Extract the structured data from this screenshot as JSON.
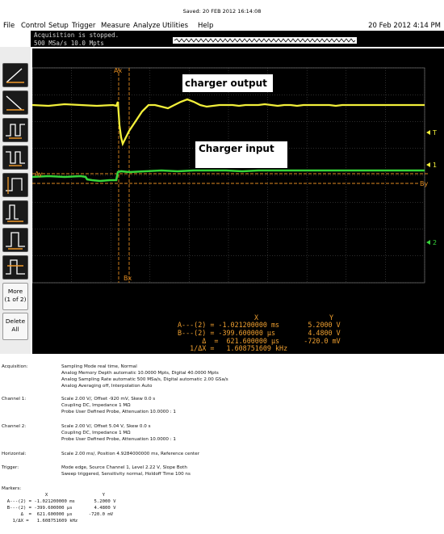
{
  "saved_line": "Saved:  20 FEB 2012  16:14:08",
  "menu": {
    "items": [
      "File",
      "Control",
      "Setup",
      "Trigger",
      "Measure",
      "Analyze",
      "Utilities",
      "Help"
    ],
    "datetime": "20 Feb 2012   4:14 PM"
  },
  "status": {
    "line1": "Acquisition is stopped.",
    "line2": "500 MSa/s    10.0 Mpts"
  },
  "toolbar": {
    "icons": [
      "rising-edge-icon",
      "falling-edge-icon",
      "pulse-width-icon",
      "pulse-width-inverse-icon",
      "timeout-icon",
      "runt-icon",
      "transition-icon",
      "setup-hold-icon",
      "glitch-icon"
    ],
    "more_label_1": "More",
    "more_label_2": "(1 of 2)",
    "delete_label_1": "Delete",
    "delete_label_2": "All"
  },
  "screen": {
    "annotation_output": "charger output",
    "annotation_input": "Charger input",
    "marker_ax": "Ax",
    "marker_bx": "Bx",
    "marker_ay": "Ay",
    "marker_by": "By",
    "marker_t": "T",
    "marker_ch1": "1",
    "marker_ch2": "2",
    "colors": {
      "channel1": "#f2ef3a",
      "channel2": "#36d43a",
      "cursor": "#e08a20",
      "grid": "#5a5a5a",
      "readout": "#f0a030"
    }
  },
  "readout": {
    "header_x": "X",
    "header_y": "Y",
    "row_a": "A---(2) = -1.021200000 ms       5.2000 V",
    "row_b": "B---(2) = -399.600000 µs        4.4800 V",
    "row_delta": "      Δ  =  621.600000 µs      -720.0 mV",
    "row_inv": "   1/ΔX =   1.608751609 kHz"
  },
  "report": {
    "acquisition_label": "Acquisition:",
    "acquisition_lines": [
      "Sampling Mode real time, Normal",
      "Analog Memory Depth automatic 10.0000 Mpts, Digital 40.0000 Mpts",
      "Analog Sampling Rate automatic 500 MSa/s, Digital automatic 2.00 GSa/s",
      "Analog Averaging off, Interpolation Auto"
    ],
    "channel1_label": "Channel 1:",
    "channel1_lines": [
      "Scale 2.00 V/, Offset -920 mV, Skew 0.0 s",
      "Coupling DC, Impedance 1 MΩ",
      "Probe User Defined Probe, Attenuation 10.0000 : 1"
    ],
    "channel2_label": "Channel 2:",
    "channel2_lines": [
      "Scale 2.00 V/, Offset 5.04 V, Skew 0.0 s",
      "Coupling DC, Impedance 1 MΩ",
      "Probe User Defined Probe, Attenuation 10.0000 : 1"
    ],
    "horizontal_label": "Horizontal:",
    "horizontal_lines": [
      "Scale 2.00 ms/, Position 4.9284000000 ms, Reference center"
    ],
    "trigger_label": "Trigger:",
    "trigger_lines": [
      "Mode edge, Source Channel 1, Level 2.22 V, Slope Both",
      "Sweep triggered, Sensitivity normal, Holdoff Time 100 ns"
    ],
    "markers_label": "Markers:",
    "markers_header": "                X                    Y",
    "markers_rows": [
      "  A---(2) = -1.021200000 ms       5.2000 V",
      "  B---(2) = -399.600000 µs        4.4800 V",
      "       Δ  =  621.600000 µs      -720.0 mV",
      "    1/ΔX =   1.608751609 kHz"
    ]
  }
}
